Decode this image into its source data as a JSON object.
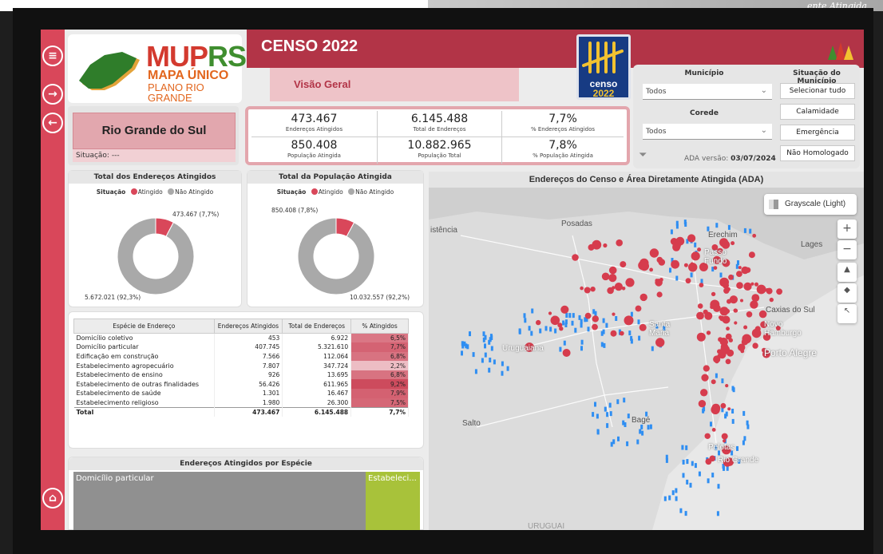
{
  "header": {
    "logo": {
      "line1a": "MUP",
      "line1b": "RS",
      "line2": "MAPA ÚNICO",
      "line3": "PLANO RIO GRANDE"
    },
    "title": "CENSO 2022",
    "subtitle": "Visão Geral",
    "censo_logo": {
      "line1": "censo",
      "line2": "2022"
    }
  },
  "map_corner_text": "ente Atingida",
  "rail": {
    "icons": [
      "menu-icon",
      "forward-arrow-icon",
      "back-arrow-icon",
      "home-icon"
    ]
  },
  "filters": {
    "municipio": {
      "label": "Município",
      "value": "Todos"
    },
    "corede": {
      "label": "Corede",
      "value": "Todos"
    },
    "situacao": {
      "label": "Situação do Município",
      "options": [
        "Selecionar tudo",
        "Calamidade",
        "Emergência",
        "Não Homologado"
      ]
    },
    "ada_version_label": "ADA versão:",
    "ada_version_date": "03/07/2024"
  },
  "state": {
    "name": "Rio Grande do Sul",
    "situacao": "Situação: ---"
  },
  "kpis": [
    {
      "value": "473.467",
      "label": "Endereços Atingidos"
    },
    {
      "value": "6.145.488",
      "label": "Total de Endereços"
    },
    {
      "value": "7,7%",
      "label": "% Endereços Atingidos"
    },
    {
      "value": "850.408",
      "label": "População Atingida"
    },
    {
      "value": "10.882.965",
      "label": "População Total"
    },
    {
      "value": "7,8%",
      "label": "% População Atingida"
    }
  ],
  "donut_legend": {
    "title": "Situação",
    "atingido": "Atingido",
    "nao_atingido": "Não Atingido"
  },
  "colors": {
    "atingido": "#d9475a",
    "nao_atingido": "#a9a9a9",
    "accent": "#b23447",
    "map_red": "#d63c4d",
    "map_blue": "#2f8ef2",
    "treemap_green": "#a8c23a"
  },
  "chart_data": [
    {
      "type": "pie",
      "title": "Total dos Endereços Atingidos",
      "categories": [
        "Atingido",
        "Não Atingido"
      ],
      "values": [
        473467,
        5672021
      ],
      "labels": [
        "473.467 (7,7%)",
        "5.672.021 (92,3%)"
      ]
    },
    {
      "type": "pie",
      "title": "Total da População Atingida",
      "categories": [
        "Atingido",
        "Não Atingido"
      ],
      "values": [
        850408,
        10032557
      ],
      "labels": [
        "850.408 (7,8%)",
        "10.032.557 (92,2%)"
      ]
    },
    {
      "type": "table",
      "columns": [
        "Espécie de Endereço",
        "Endereços Atingidos",
        "Total de Endereços",
        "% Atingidos"
      ],
      "rows": [
        {
          "name": "Domicílio coletivo",
          "atingidos": "453",
          "total": "6.922",
          "pct": "6,5%",
          "pct_value": 6.5
        },
        {
          "name": "Domicílio particular",
          "atingidos": "407.745",
          "total": "5.321.610",
          "pct": "7,7%",
          "pct_value": 7.7
        },
        {
          "name": "Edificação em construção",
          "atingidos": "7.566",
          "total": "112.064",
          "pct": "6,8%",
          "pct_value": 6.8
        },
        {
          "name": "Estabelecimento agropecuário",
          "atingidos": "7.807",
          "total": "347.724",
          "pct": "2,2%",
          "pct_value": 2.2
        },
        {
          "name": "Estabelecimento de ensino",
          "atingidos": "926",
          "total": "13.695",
          "pct": "6,8%",
          "pct_value": 6.8
        },
        {
          "name": "Estabelecimento de outras finalidades",
          "atingidos": "56.426",
          "total": "611.965",
          "pct": "9,2%",
          "pct_value": 9.2
        },
        {
          "name": "Estabelecimento de saúde",
          "atingidos": "1.301",
          "total": "16.467",
          "pct": "7,9%",
          "pct_value": 7.9
        },
        {
          "name": "Estabelecimento religioso",
          "atingidos": "1.980",
          "total": "26.300",
          "pct": "7,5%",
          "pct_value": 7.5
        }
      ],
      "total": {
        "name": "Total",
        "atingidos": "473.467",
        "total": "6.145.488",
        "pct": "7,7%"
      }
    },
    {
      "type": "bar",
      "title": "Endereços Atingidos por Espécie",
      "categories": [
        "Domicílio particular",
        "Estabeleci..."
      ],
      "values": [
        407745,
        56426
      ]
    }
  ],
  "map": {
    "title": "Endereços do Censo e Área Diretamente Atingida (ADA)",
    "basemap": "Grayscale (Light)",
    "controls": [
      "+",
      "−",
      "▲",
      "◆",
      "↖"
    ],
    "cities": [
      "Posadas",
      "Erechim",
      "Lages",
      "Passo Fundo",
      "Caxias do Sul",
      "Santa Maria",
      "Novo Hamburgo",
      "Porto Alegre",
      "Uruguaiana",
      "Salto",
      "Bagé",
      "Pelotas",
      "Rio Grande",
      "istência",
      "URUGUAI"
    ]
  }
}
